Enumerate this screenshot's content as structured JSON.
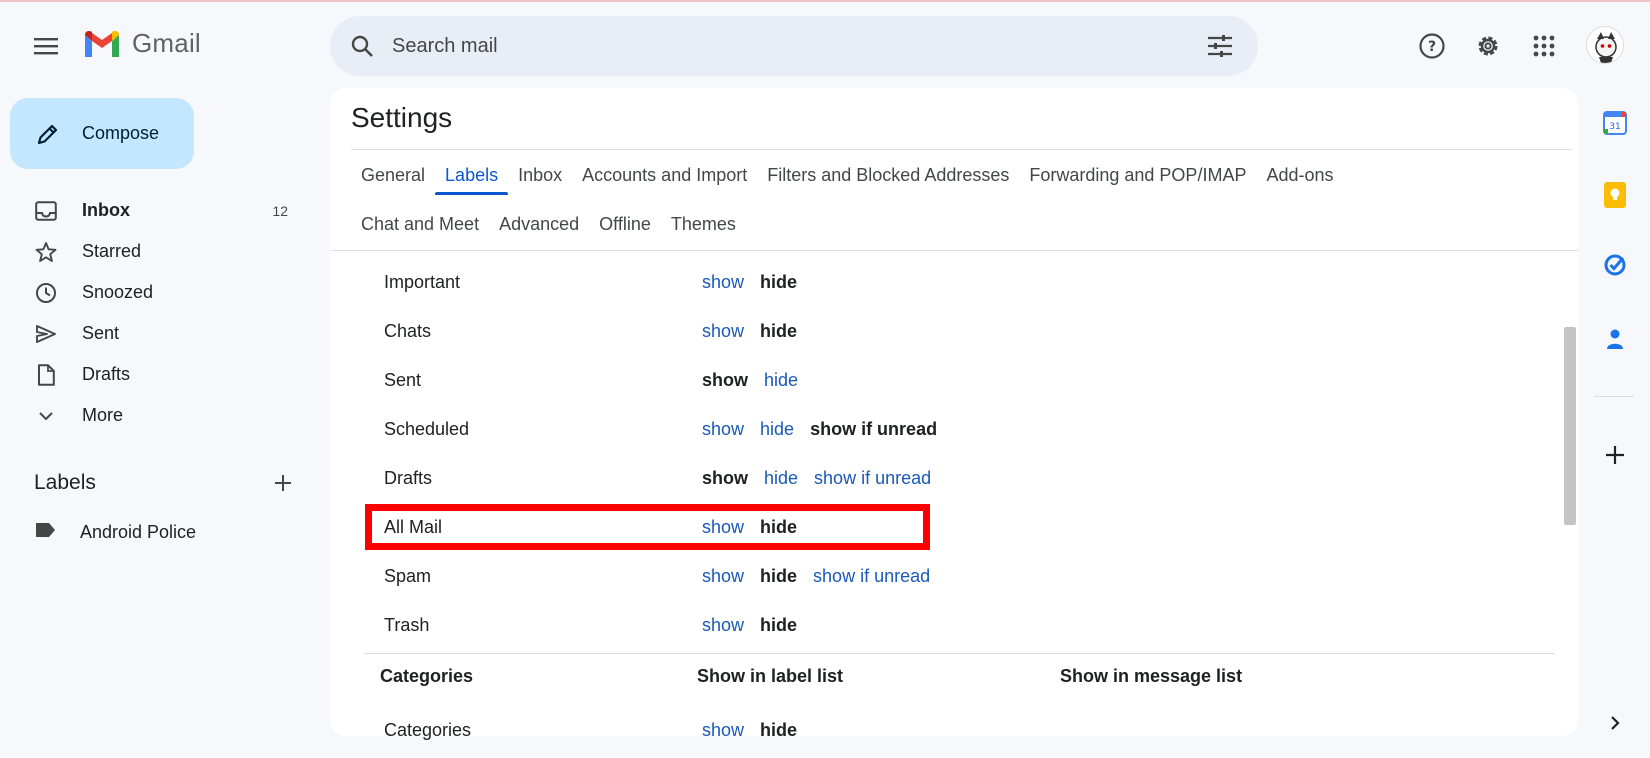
{
  "app": {
    "name": "Gmail"
  },
  "search": {
    "placeholder": "Search mail"
  },
  "compose": {
    "label": "Compose"
  },
  "nav": [
    {
      "label": "Inbox",
      "count": "12",
      "icon": "inbox-icon"
    },
    {
      "label": "Starred",
      "count": "",
      "icon": "star-icon"
    },
    {
      "label": "Snoozed",
      "count": "",
      "icon": "clock-icon"
    },
    {
      "label": "Sent",
      "count": "",
      "icon": "send-icon"
    },
    {
      "label": "Drafts",
      "count": "",
      "icon": "draft-icon"
    },
    {
      "label": "More",
      "count": "",
      "icon": "chevron-down-icon"
    }
  ],
  "labels": {
    "heading": "Labels",
    "items": [
      {
        "label": "Android Police",
        "icon": "label-icon"
      }
    ]
  },
  "settings": {
    "title": "Settings",
    "tabs_row1": [
      "General",
      "Labels",
      "Inbox",
      "Accounts and Import",
      "Filters and Blocked Addresses",
      "Forwarding and POP/IMAP",
      "Add-ons"
    ],
    "tabs_row2": [
      "Chat and Meet",
      "Advanced",
      "Offline",
      "Themes"
    ],
    "active_tab": "Labels",
    "system_labels": [
      {
        "name": "Important",
        "show": "show",
        "hide": "hide",
        "selected": "hide"
      },
      {
        "name": "Chats",
        "show": "show",
        "hide": "hide",
        "selected": "hide"
      },
      {
        "name": "Sent",
        "show": "show",
        "hide": "hide",
        "selected": "show"
      },
      {
        "name": "Scheduled",
        "show": "show",
        "hide": "hide",
        "unread": "show if unread",
        "selected": "unread"
      },
      {
        "name": "Drafts",
        "show": "show",
        "hide": "hide",
        "unread": "show if unread",
        "selected": "show"
      },
      {
        "name": "All Mail",
        "show": "show",
        "hide": "hide",
        "selected": "hide",
        "highlighted": true
      },
      {
        "name": "Spam",
        "show": "show",
        "hide": "hide",
        "unread": "show if unread",
        "selected": "hide"
      },
      {
        "name": "Trash",
        "show": "show",
        "hide": "hide",
        "selected": "hide"
      }
    ],
    "categories": {
      "headers": [
        "Categories",
        "Show in label list",
        "Show in message list"
      ],
      "row": {
        "name": "Categories",
        "show": "show",
        "hide": "hide",
        "selected": "hide"
      }
    }
  },
  "colors": {
    "accent": "#0b57d0",
    "link": "#1a59b8",
    "highlight_box": "#ff0000",
    "compose_bg": "#c2e7ff"
  }
}
